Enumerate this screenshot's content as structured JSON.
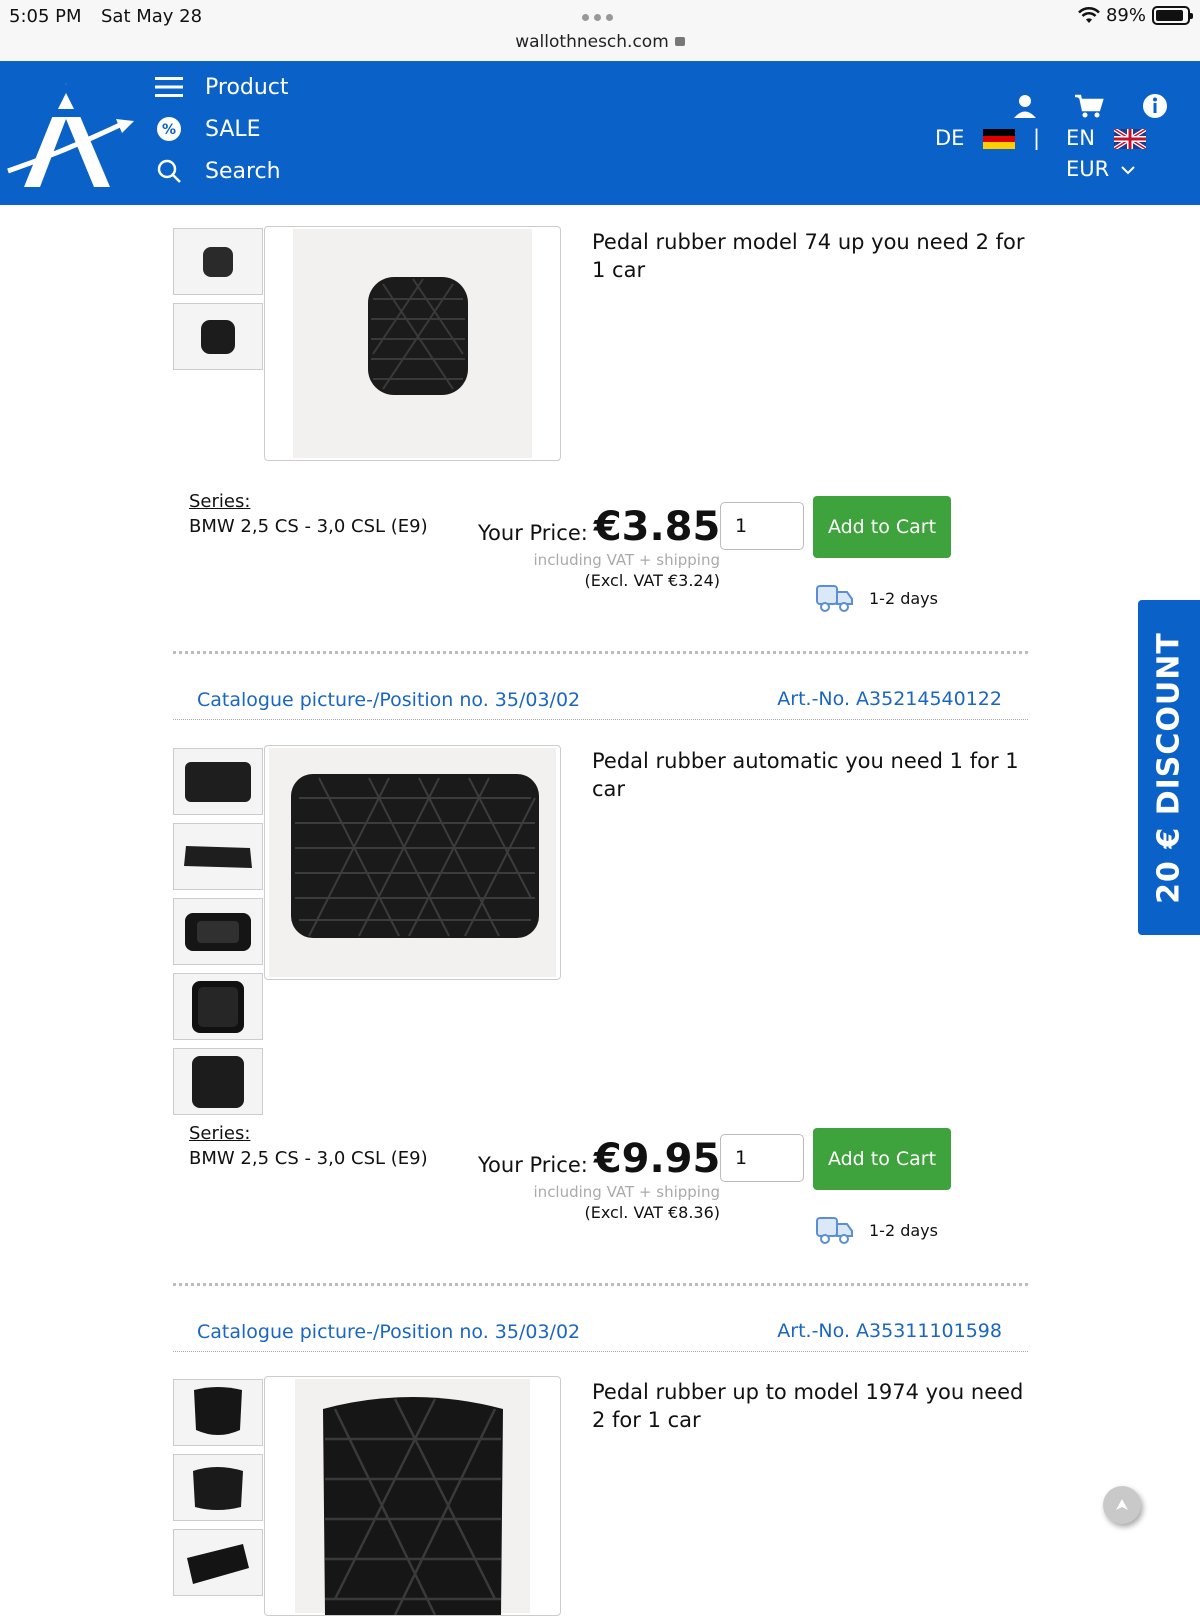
{
  "status_bar": {
    "time": "5:05 PM",
    "date": "Sat May 28",
    "url": "wallothnesch.com",
    "battery": "89%",
    "battery_level": 0.89
  },
  "header": {
    "nav": [
      {
        "label": "Product",
        "icon": "hamburger-icon"
      },
      {
        "label": "SALE",
        "icon": "percent-icon"
      },
      {
        "label": "Search",
        "icon": "search-icon"
      }
    ],
    "icons": [
      "user-icon",
      "cart-icon",
      "info-icon"
    ],
    "lang_de": "DE",
    "separator": "|",
    "lang_en": "EN",
    "currency": "EUR",
    "brand_color": "#0a61c7"
  },
  "products": [
    {
      "title": "Pedal rubber model 74 up you need 2 for 1 car",
      "series_label": "Series:",
      "series_value": "BMW 2,5 CS - 3,0 CSL (E9)",
      "price_label": "Your Price:",
      "price": "€3.85",
      "vat_note": "including VAT + shipping",
      "excl_vat": "(Excl. VAT €3.24)",
      "qty": "1",
      "cart_label": "Add to Cart",
      "delivery": "1-2 days",
      "thumb_count": 2
    },
    {
      "catalogue": "Catalogue picture-/Position no. 35/03/02",
      "art_no": "Art.-No. A35214540122",
      "title": "Pedal rubber automatic you need 1 for 1 car",
      "series_label": "Series:",
      "series_value": "BMW 2,5 CS - 3,0 CSL (E9)",
      "price_label": "Your Price:",
      "price": "€9.95",
      "vat_note": "including VAT + shipping",
      "excl_vat": "(Excl. VAT €8.36)",
      "qty": "1",
      "cart_label": "Add to Cart",
      "delivery": "1-2 days",
      "thumb_count": 5
    },
    {
      "catalogue": "Catalogue picture-/Position no. 35/03/02",
      "art_no": "Art.-No. A35311101598",
      "title": "Pedal rubber up to model 1974 you need 2 for 1 car",
      "thumb_count": 3
    }
  ],
  "discount_tab": "20 € DISCOUNT",
  "colors": {
    "cart_button": "#3ea33c",
    "link": "#1a66c2"
  }
}
